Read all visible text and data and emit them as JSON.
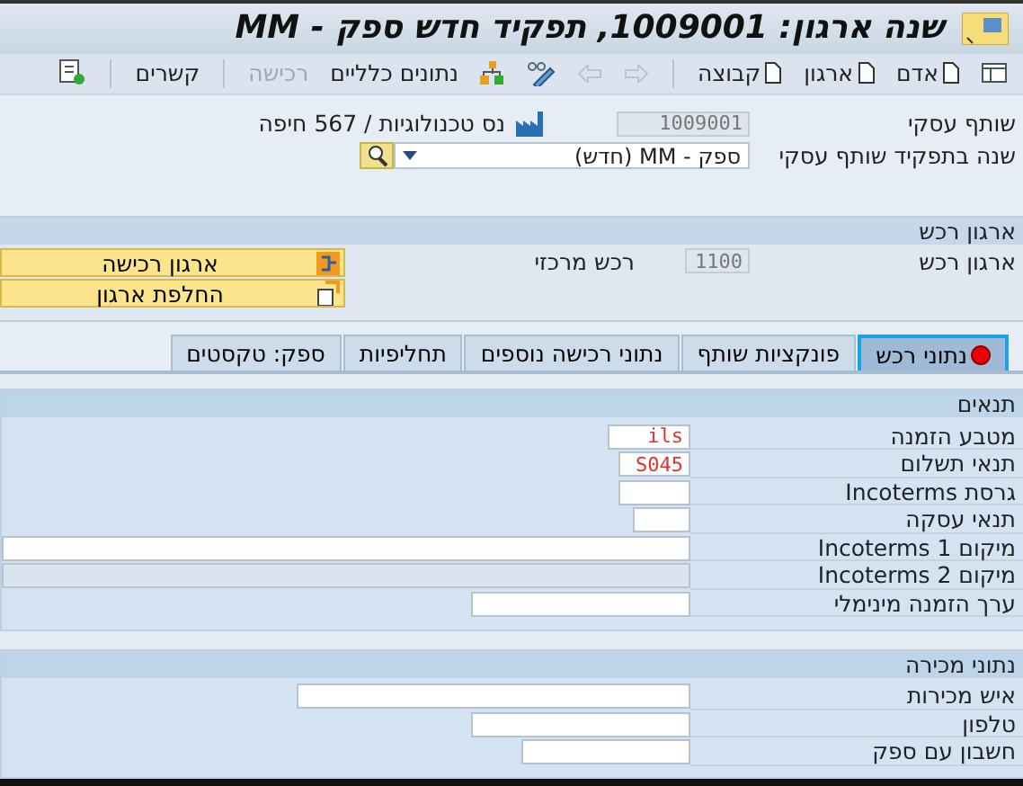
{
  "window": {
    "title": "שנה ארגון: 1009001, תפקיד חדש ספק - MM"
  },
  "toolbar": [
    {
      "kind": "panel"
    },
    {
      "kind": "doc",
      "label": "אדם"
    },
    {
      "kind": "doc",
      "label": "ארגון"
    },
    {
      "kind": "doc",
      "label": "קבוצה"
    },
    {
      "kind": "separator"
    },
    {
      "kind": "arrow_right",
      "disabled": true
    },
    {
      "kind": "arrow_left",
      "disabled": true
    },
    {
      "kind": "pencil"
    },
    {
      "kind": "org"
    },
    {
      "kind": "text",
      "label": "נתונים כלליים",
      "disabled": false
    },
    {
      "kind": "text",
      "label": "רכישה",
      "disabled": true
    },
    {
      "kind": "separator"
    },
    {
      "kind": "text",
      "label": "קשרים",
      "disabled": false
    },
    {
      "kind": "separator"
    },
    {
      "kind": "relations"
    }
  ],
  "header": {
    "partner_label": "שותף עסקי",
    "partner_value": "1009001",
    "partner_name": "נס טכנולוגיות / 567 חיפה",
    "role_label": "שנה בתפקיד שותף עסקי",
    "role_value": "ספק - MM (חדש)"
  },
  "purchasing_org": {
    "title": "ארגון רכש",
    "label": "ארגון רכש",
    "value": "1100",
    "description": "רכש מרכזי",
    "buttons": [
      {
        "label": "ארגון רכישה",
        "kind": "org"
      },
      {
        "label": "החלפת ארגון",
        "kind": "switch"
      }
    ]
  },
  "tabs": [
    {
      "label": "נתוני רכש",
      "selected": true,
      "error": true
    },
    {
      "label": "פונקציות שותף",
      "selected": false,
      "error": false
    },
    {
      "label": "נתוני רכישה נוספים",
      "selected": false,
      "error": false
    },
    {
      "label": "תחליפיות",
      "selected": false,
      "error": false
    },
    {
      "label": "ספק: טקסטים",
      "selected": false,
      "error": false
    }
  ],
  "sections": [
    {
      "title": "תנאים",
      "fields": [
        {
          "label": "מטבע הזמנה",
          "value": "ils",
          "readonly": false
        },
        {
          "label": "תנאי תשלום",
          "value": "S045",
          "readonly": false
        },
        {
          "label": "גרסת Incoterms",
          "readonly": false
        },
        {
          "label": "תנאי עסקה",
          "readonly": false
        },
        {
          "label": "מיקום Incoterms 1",
          "readonly": false
        },
        {
          "label": "מיקום Incoterms 2",
          "readonly": true
        },
        {
          "label": "ערך הזמנה מינימלי",
          "readonly": false
        }
      ]
    },
    {
      "title": "נתוני מכירה",
      "fields": [
        {
          "label": "איש מכירות",
          "readonly": false
        },
        {
          "label": "טלפון",
          "readonly": false
        },
        {
          "label": "חשבון עם ספק",
          "readonly": false
        }
      ]
    }
  ]
}
